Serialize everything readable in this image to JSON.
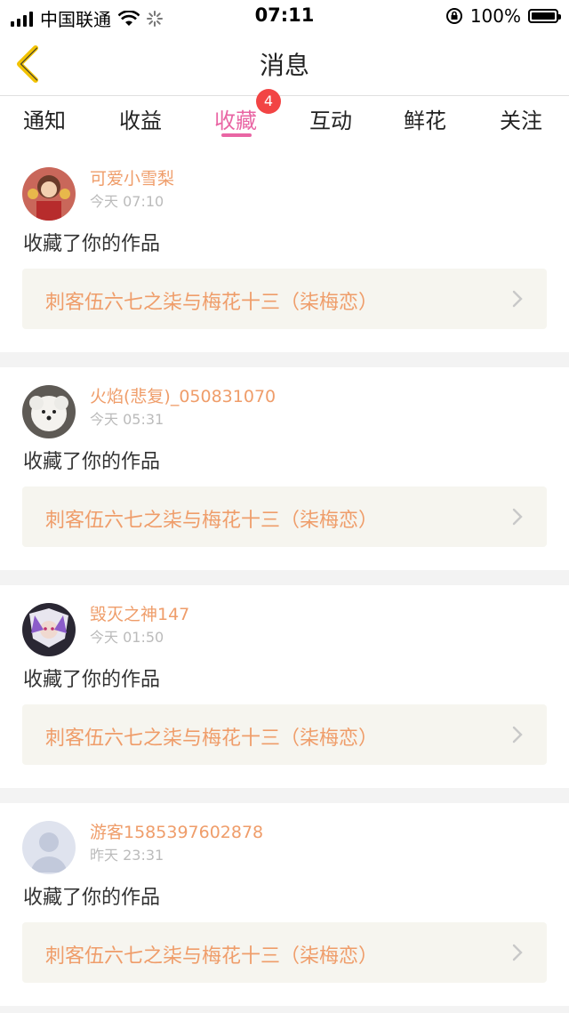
{
  "status_bar": {
    "carrier": "中国联通",
    "time": "07:11",
    "battery_percent": "100%"
  },
  "nav": {
    "title": "消息"
  },
  "tabs": [
    {
      "label": "通知"
    },
    {
      "label": "收益"
    },
    {
      "label": "收藏",
      "active": true,
      "badge": "4"
    },
    {
      "label": "互动"
    },
    {
      "label": "鲜花"
    },
    {
      "label": "关注"
    }
  ],
  "messages": [
    {
      "username": "可爱小雪梨",
      "time": "今天 07:10",
      "action": "收藏了你的作品",
      "work_title": "刺客伍六七之柒与梅花十三（柒梅恋）",
      "avatar_icon": "cartoon-avatar"
    },
    {
      "username": "火焰(悲复)_050831070",
      "time": "今天 05:31",
      "action": "收藏了你的作品",
      "work_title": "刺客伍六七之柒与梅花十三（柒梅恋）",
      "avatar_icon": "dog-avatar"
    },
    {
      "username": "毁灭之神147",
      "time": "今天 01:50",
      "action": "收藏了你的作品",
      "work_title": "刺客伍六七之柒与梅花十三（柒梅恋）",
      "avatar_icon": "anime-avatar"
    },
    {
      "username": "游客1585397602878",
      "time": "昨天 23:31",
      "action": "收藏了你的作品",
      "work_title": "刺客伍六七之柒与梅花十三（柒梅恋）",
      "avatar_icon": "default-user-avatar"
    }
  ],
  "colors": {
    "accent": "#e966a4",
    "username": "#ef9d6a",
    "badge": "#f24444",
    "back_arrow": "#f2c200"
  }
}
